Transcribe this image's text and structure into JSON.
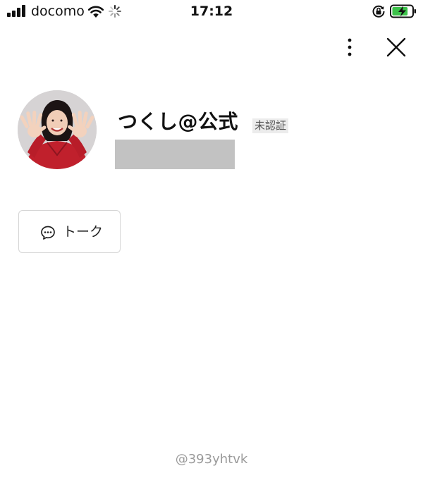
{
  "status_bar": {
    "carrier": "docomo",
    "time": "17:12",
    "signal_bars": 4,
    "battery_level": 0.8,
    "battery_color": "#3cc24a",
    "charging": true,
    "icons": [
      "signal-icon",
      "wifi-icon",
      "loading-spinner-icon",
      "rotation-lock-icon",
      "battery-charging-icon"
    ]
  },
  "header": {
    "icons": [
      "more-vertical-icon",
      "close-icon"
    ]
  },
  "profile": {
    "name": "つくし@公式",
    "badge": "未認証"
  },
  "actions": {
    "talk_label": "トーク",
    "talk_icon": "chat-bubble-icon"
  },
  "footer": {
    "id_text": "@393yhtvk"
  }
}
